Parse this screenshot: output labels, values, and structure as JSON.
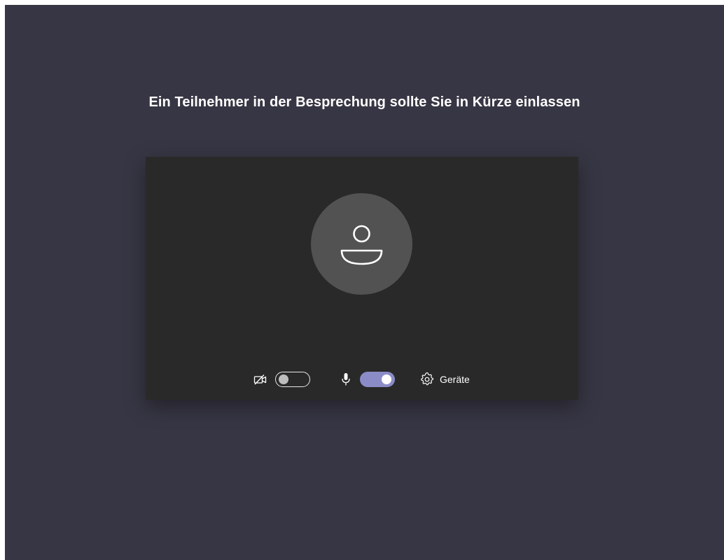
{
  "lobby": {
    "title": "Ein Teilnehmer in der Besprechung sollte Sie in Kürze einlassen"
  },
  "controls": {
    "camera": {
      "icon": "camera-off-icon",
      "state": "off"
    },
    "microphone": {
      "icon": "microphone-icon",
      "state": "on"
    },
    "devices": {
      "icon": "gear-icon",
      "label": "Geräte"
    }
  },
  "colors": {
    "background": "#373644",
    "preview": "#292929",
    "avatar": "#525252",
    "toggle_on": "#8b8cc7"
  }
}
